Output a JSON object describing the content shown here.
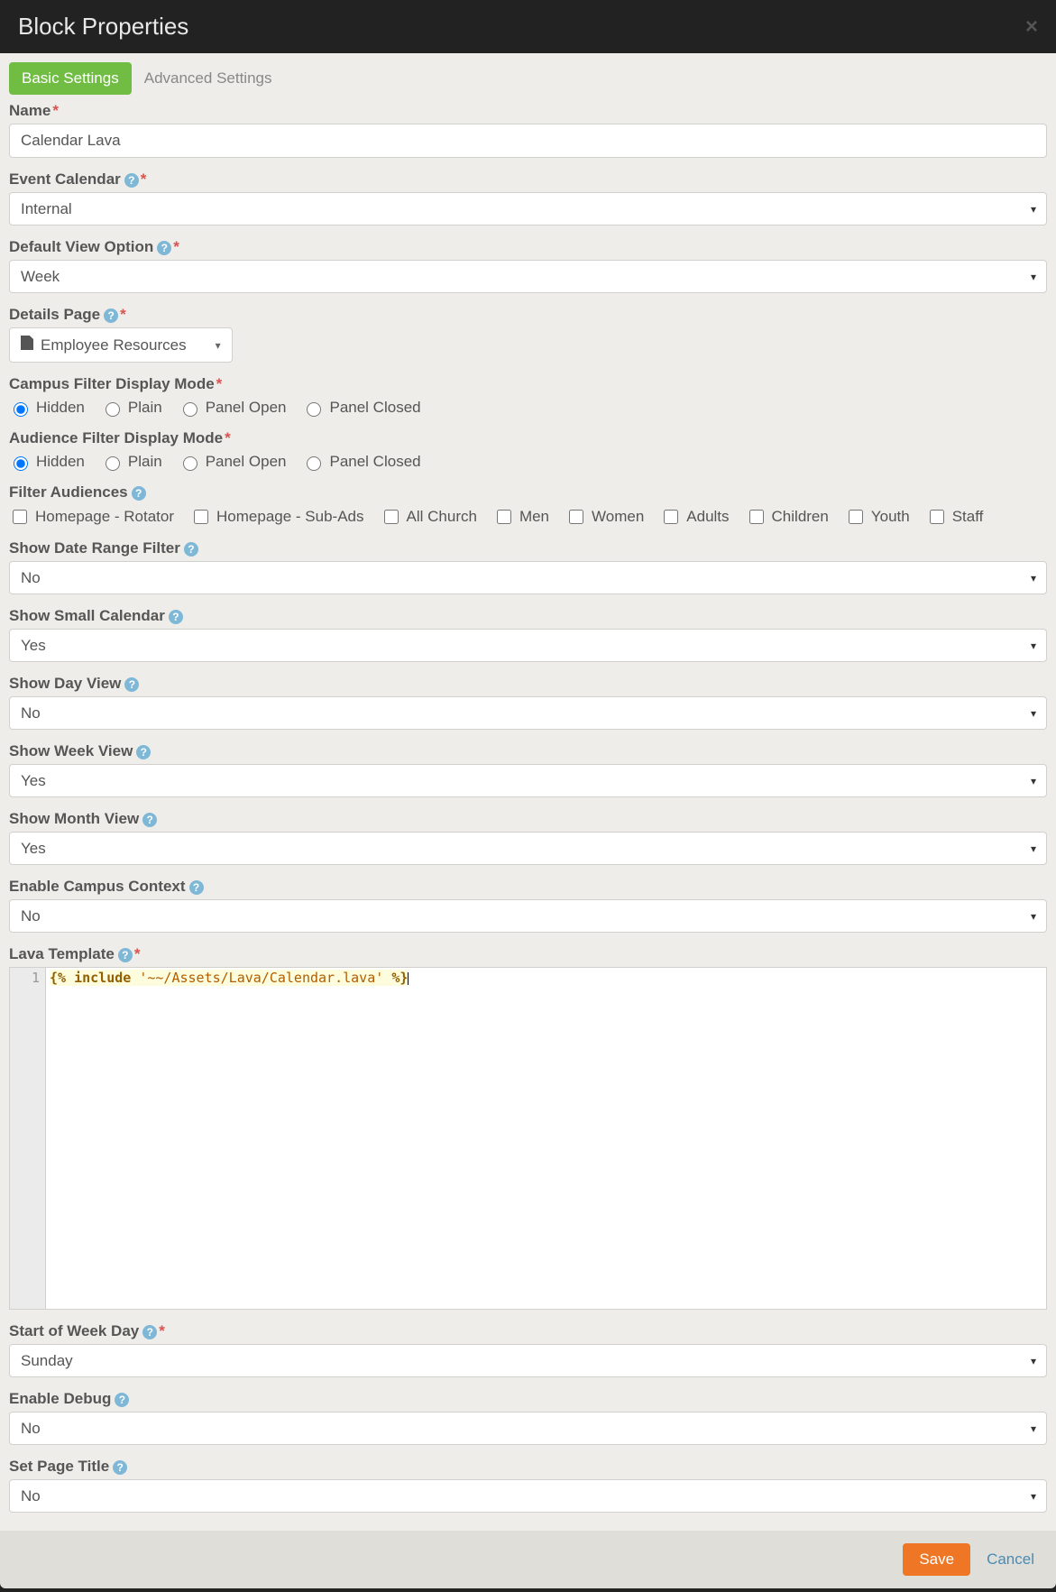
{
  "modal": {
    "title": "Block Properties"
  },
  "tabs": {
    "basic": "Basic Settings",
    "advanced": "Advanced Settings"
  },
  "fields": {
    "name": {
      "label": "Name",
      "value": "Calendar Lava"
    },
    "eventCalendar": {
      "label": "Event Calendar",
      "value": "Internal"
    },
    "defaultView": {
      "label": "Default View Option",
      "value": "Week"
    },
    "detailsPage": {
      "label": "Details Page",
      "value": "Employee Resources"
    },
    "campusFilterMode": {
      "label": "Campus Filter Display Mode",
      "options": [
        "Hidden",
        "Plain",
        "Panel Open",
        "Panel Closed"
      ],
      "selected": "Hidden"
    },
    "audienceFilterMode": {
      "label": "Audience Filter Display Mode",
      "options": [
        "Hidden",
        "Plain",
        "Panel Open",
        "Panel Closed"
      ],
      "selected": "Hidden"
    },
    "filterAudiences": {
      "label": "Filter Audiences",
      "options": [
        "Homepage - Rotator",
        "Homepage - Sub-Ads",
        "All Church",
        "Men",
        "Women",
        "Adults",
        "Children",
        "Youth",
        "Staff"
      ]
    },
    "showDateRange": {
      "label": "Show Date Range Filter",
      "value": "No"
    },
    "showSmallCalendar": {
      "label": "Show Small Calendar",
      "value": "Yes"
    },
    "showDayView": {
      "label": "Show Day View",
      "value": "No"
    },
    "showWeekView": {
      "label": "Show Week View",
      "value": "Yes"
    },
    "showMonthView": {
      "label": "Show Month View",
      "value": "Yes"
    },
    "enableCampusContext": {
      "label": "Enable Campus Context",
      "value": "No"
    },
    "lavaTemplate": {
      "label": "Lava Template",
      "lineNumber": "1",
      "code": {
        "open": "{%",
        "kw": "include",
        "str": "'~~/Assets/Lava/Calendar.lava'",
        "close": "%}"
      }
    },
    "startOfWeek": {
      "label": "Start of Week Day",
      "value": "Sunday"
    },
    "enableDebug": {
      "label": "Enable Debug",
      "value": "No"
    },
    "setPageTitle": {
      "label": "Set Page Title",
      "value": "No"
    }
  },
  "footer": {
    "save": "Save",
    "cancel": "Cancel"
  }
}
